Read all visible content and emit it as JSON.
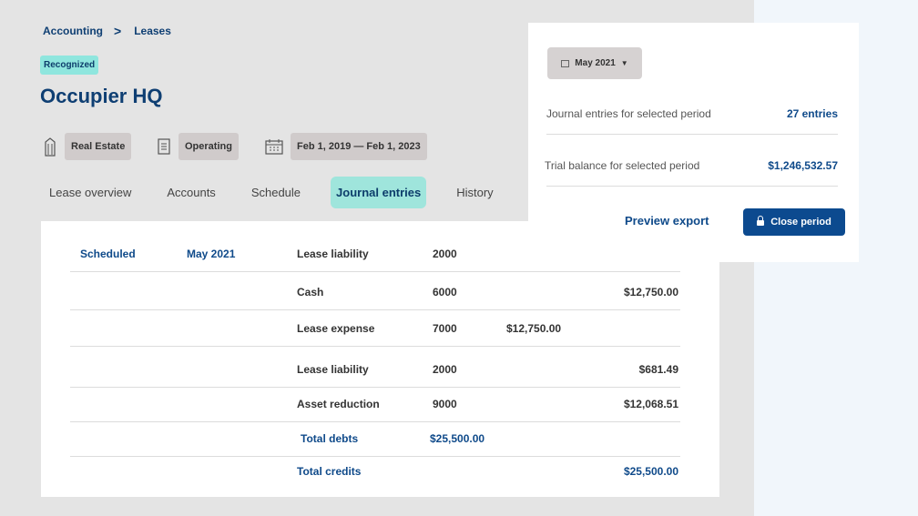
{
  "breadcrumb": {
    "parent": "Accounting",
    "separator": ">",
    "current": "Leases"
  },
  "status_badge": "Recognized",
  "page_title": "Occupier HQ",
  "meta": {
    "category": "Real Estate",
    "type": "Operating",
    "date_range": "Feb 1, 2019 — Feb 1, 2023"
  },
  "tabs": [
    {
      "label": "Lease overview",
      "active": false
    },
    {
      "label": "Accounts",
      "active": false
    },
    {
      "label": "Schedule",
      "active": false
    },
    {
      "label": "Journal entries",
      "active": true
    },
    {
      "label": "History",
      "active": false
    }
  ],
  "journal_rows": [
    {
      "status": "Scheduled",
      "period": "May 2021",
      "account": "Lease liability",
      "code": "2000",
      "debit": "",
      "credit": ""
    },
    {
      "status": "",
      "period": "",
      "account": "Cash",
      "code": "6000",
      "debit": "",
      "credit": "$12,750.00"
    },
    {
      "status": "",
      "period": "",
      "account": "Lease expense",
      "code": "7000",
      "debit": "$12,750.00",
      "credit": ""
    },
    {
      "status": "",
      "period": "",
      "account": "Lease liability",
      "code": "2000",
      "debit": "",
      "credit": "$681.49"
    },
    {
      "status": "",
      "period": "",
      "account": "Asset reduction",
      "code": "9000",
      "debit": "",
      "credit": "$12,068.51"
    }
  ],
  "totals": {
    "debits_label": "Total debts",
    "debits_value": "$25,500.00",
    "credits_label": "Total credits",
    "credits_value": "$25,500.00"
  },
  "period_panel": {
    "period_selector": "May 2021",
    "entries_label": "Journal entries for selected period",
    "entries_value": "27 entries",
    "trial_label": "Trial balance for selected period",
    "trial_value": "$1,246,532.57",
    "preview_export": "Preview export",
    "close_period": "Close period"
  },
  "colors": {
    "accent": "#0c4a8f",
    "tab_active": "#9fe5dc",
    "badge": "#8fe6de",
    "background": "#e4e4e4"
  },
  "icons": {
    "category": "building-icon",
    "type": "document-icon",
    "date": "calendar-icon",
    "period": "calendar-icon",
    "close": "lock-icon"
  }
}
